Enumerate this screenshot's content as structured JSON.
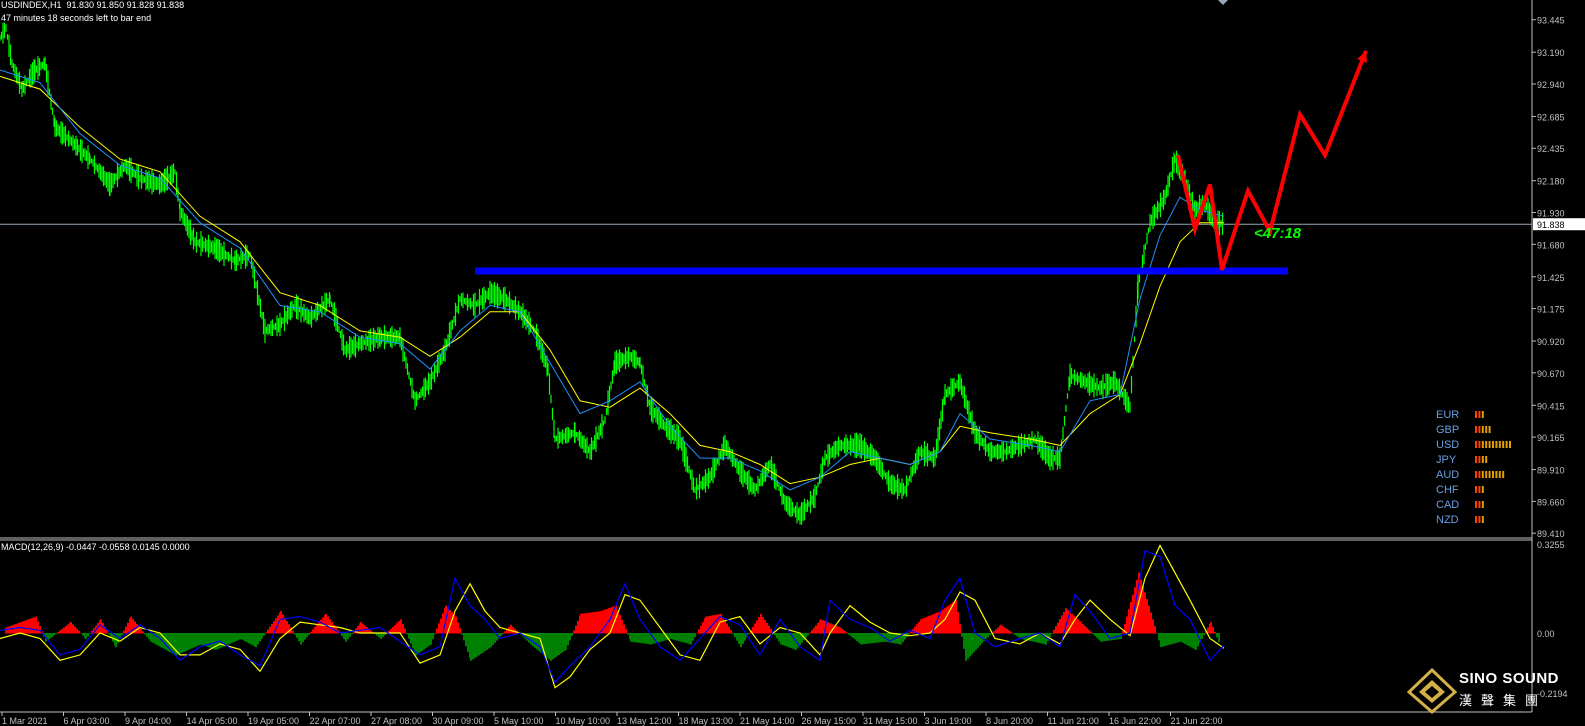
{
  "header": {
    "symbol_line": "USDINDEX,H1  91.830 91.850 91.828 91.838",
    "timer_line": "47 minutes 18 seconds left to bar end"
  },
  "macd": {
    "label": "MACD(12,26,9) -0.0447 -0.0558 0.0145 0.0000"
  },
  "countdown": "<47:18",
  "current_price": "91.838",
  "watermark": {
    "name": "SINO SOUND",
    "cjk": "漢聲集團"
  },
  "colors": {
    "candles": "#00ff00",
    "fast_ma": "#1e90ff",
    "slow_ma": "#ffff00",
    "support": "#0000ff",
    "forecast": "#ff0000",
    "histogram_up": "#ff0000",
    "histogram_down": "#008000",
    "macd_line": "#0000ff",
    "signal_line": "#ffff00",
    "axis_text": "#c0c0c0"
  },
  "chart_data": {
    "type": "line",
    "price_axis_ticks": [
      "93.445",
      "93.190",
      "92.940",
      "92.685",
      "92.435",
      "92.180",
      "91.930",
      "91.680",
      "91.425",
      "91.175",
      "90.920",
      "90.670",
      "90.415",
      "90.165",
      "89.910",
      "89.660",
      "89.410"
    ],
    "ylim": [
      89.38,
      93.6
    ],
    "macd_axis_ticks": [
      "0.3255",
      "0.00",
      "-0.2194"
    ],
    "macd_ylim": [
      -0.245,
      0.34
    ],
    "time_axis_ticks": [
      "1 Mar 2021",
      "6 Apr 03:00",
      "9 Apr 04:00",
      "14 Apr 05:00",
      "19 Apr 05:00",
      "22 Apr 07:00",
      "27 Apr 08:00",
      "30 Apr 09:00",
      "5 May 10:00",
      "10 May 10:00",
      "13 May 12:00",
      "18 May 13:00",
      "21 May 14:00",
      "26 May 15:00",
      "31 May 15:00",
      "3 Jun 19:00",
      "8 Jun 20:00",
      "11 Jun 21:00",
      "16 Jun 22:00",
      "21 Jun 22:00"
    ],
    "price_path": [
      [
        0,
        93.3
      ],
      [
        6,
        93.38
      ],
      [
        12,
        93.1
      ],
      [
        22,
        92.9
      ],
      [
        35,
        93.05
      ],
      [
        45,
        93.1
      ],
      [
        55,
        92.6
      ],
      [
        70,
        92.5
      ],
      [
        90,
        92.35
      ],
      [
        110,
        92.15
      ],
      [
        125,
        92.3
      ],
      [
        140,
        92.2
      ],
      [
        160,
        92.15
      ],
      [
        175,
        92.25
      ],
      [
        180,
        91.95
      ],
      [
        195,
        91.7
      ],
      [
        215,
        91.65
      ],
      [
        235,
        91.55
      ],
      [
        250,
        91.6
      ],
      [
        265,
        91.0
      ],
      [
        280,
        91.05
      ],
      [
        295,
        91.2
      ],
      [
        310,
        91.1
      ],
      [
        330,
        91.25
      ],
      [
        345,
        90.85
      ],
      [
        360,
        90.9
      ],
      [
        380,
        90.95
      ],
      [
        400,
        90.95
      ],
      [
        415,
        90.45
      ],
      [
        430,
        90.6
      ],
      [
        445,
        90.85
      ],
      [
        460,
        91.25
      ],
      [
        475,
        91.2
      ],
      [
        490,
        91.3
      ],
      [
        505,
        91.25
      ],
      [
        520,
        91.15
      ],
      [
        535,
        91.0
      ],
      [
        548,
        90.7
      ],
      [
        555,
        90.15
      ],
      [
        575,
        90.2
      ],
      [
        590,
        90.05
      ],
      [
        605,
        90.3
      ],
      [
        615,
        90.75
      ],
      [
        630,
        90.8
      ],
      [
        640,
        90.75
      ],
      [
        650,
        90.4
      ],
      [
        665,
        90.25
      ],
      [
        680,
        90.15
      ],
      [
        695,
        89.75
      ],
      [
        710,
        89.85
      ],
      [
        725,
        90.1
      ],
      [
        740,
        89.9
      ],
      [
        755,
        89.75
      ],
      [
        770,
        89.95
      ],
      [
        785,
        89.65
      ],
      [
        800,
        89.55
      ],
      [
        815,
        89.7
      ],
      [
        825,
        90.0
      ],
      [
        840,
        90.1
      ],
      [
        860,
        90.1
      ],
      [
        875,
        90.0
      ],
      [
        890,
        89.8
      ],
      [
        905,
        89.75
      ],
      [
        920,
        90.05
      ],
      [
        935,
        90.0
      ],
      [
        945,
        90.5
      ],
      [
        960,
        90.6
      ],
      [
        975,
        90.2
      ],
      [
        990,
        90.05
      ],
      [
        1005,
        90.05
      ],
      [
        1020,
        90.1
      ],
      [
        1035,
        90.15
      ],
      [
        1050,
        90.0
      ],
      [
        1060,
        90.0
      ],
      [
        1070,
        90.65
      ],
      [
        1085,
        90.6
      ],
      [
        1100,
        90.55
      ],
      [
        1115,
        90.6
      ],
      [
        1130,
        90.4
      ],
      [
        1138,
        91.35
      ],
      [
        1150,
        91.85
      ],
      [
        1165,
        92.05
      ],
      [
        1175,
        92.35
      ],
      [
        1185,
        92.2
      ],
      [
        1195,
        91.95
      ],
      [
        1205,
        92.0
      ],
      [
        1215,
        91.85
      ],
      [
        1224,
        91.84
      ]
    ],
    "fast_ma_path": [
      [
        0,
        93.05
      ],
      [
        40,
        92.95
      ],
      [
        80,
        92.55
      ],
      [
        120,
        92.3
      ],
      [
        160,
        92.2
      ],
      [
        200,
        91.85
      ],
      [
        240,
        91.65
      ],
      [
        280,
        91.2
      ],
      [
        320,
        91.15
      ],
      [
        360,
        90.95
      ],
      [
        400,
        90.9
      ],
      [
        430,
        90.7
      ],
      [
        460,
        91.0
      ],
      [
        490,
        91.2
      ],
      [
        520,
        91.15
      ],
      [
        550,
        90.75
      ],
      [
        580,
        90.35
      ],
      [
        610,
        90.45
      ],
      [
        640,
        90.6
      ],
      [
        670,
        90.25
      ],
      [
        700,
        90.0
      ],
      [
        730,
        90.0
      ],
      [
        760,
        89.9
      ],
      [
        790,
        89.75
      ],
      [
        820,
        89.85
      ],
      [
        850,
        90.05
      ],
      [
        880,
        90.0
      ],
      [
        910,
        89.95
      ],
      [
        940,
        90.05
      ],
      [
        960,
        90.35
      ],
      [
        990,
        90.15
      ],
      [
        1030,
        90.1
      ],
      [
        1060,
        90.05
      ],
      [
        1090,
        90.45
      ],
      [
        1120,
        90.5
      ],
      [
        1140,
        91.25
      ],
      [
        1160,
        91.75
      ],
      [
        1180,
        92.05
      ],
      [
        1200,
        91.95
      ],
      [
        1224,
        91.9
      ]
    ],
    "slow_ma_path": [
      [
        0,
        93.0
      ],
      [
        40,
        92.9
      ],
      [
        80,
        92.6
      ],
      [
        120,
        92.35
      ],
      [
        160,
        92.25
      ],
      [
        200,
        91.9
      ],
      [
        240,
        91.7
      ],
      [
        280,
        91.3
      ],
      [
        320,
        91.2
      ],
      [
        360,
        91.0
      ],
      [
        400,
        90.95
      ],
      [
        430,
        90.8
      ],
      [
        460,
        90.95
      ],
      [
        490,
        91.15
      ],
      [
        520,
        91.15
      ],
      [
        550,
        90.85
      ],
      [
        580,
        90.45
      ],
      [
        610,
        90.4
      ],
      [
        640,
        90.55
      ],
      [
        670,
        90.35
      ],
      [
        700,
        90.1
      ],
      [
        730,
        90.05
      ],
      [
        760,
        89.95
      ],
      [
        790,
        89.8
      ],
      [
        820,
        89.85
      ],
      [
        850,
        89.95
      ],
      [
        880,
        90.0
      ],
      [
        910,
        89.95
      ],
      [
        940,
        90.05
      ],
      [
        960,
        90.25
      ],
      [
        990,
        90.2
      ],
      [
        1030,
        90.15
      ],
      [
        1060,
        90.1
      ],
      [
        1090,
        90.35
      ],
      [
        1120,
        90.5
      ],
      [
        1140,
        90.9
      ],
      [
        1160,
        91.35
      ],
      [
        1180,
        91.7
      ],
      [
        1200,
        91.85
      ],
      [
        1224,
        91.85
      ]
    ],
    "support_level": 91.47,
    "support_x_range": [
      475,
      1288
    ],
    "forecast_path": [
      [
        1178,
        92.38
      ],
      [
        1195,
        91.8
      ],
      [
        1210,
        92.15
      ],
      [
        1222,
        91.48
      ],
      [
        1248,
        92.1
      ],
      [
        1270,
        91.78
      ],
      [
        1300,
        92.7
      ],
      [
        1325,
        92.38
      ],
      [
        1366,
        93.2
      ]
    ],
    "macd_histogram": [
      [
        5,
        0.02
      ],
      [
        35,
        0.06
      ],
      [
        45,
        -0.03
      ],
      [
        70,
        0.04
      ],
      [
        85,
        -0.02
      ],
      [
        100,
        0.05
      ],
      [
        115,
        -0.05
      ],
      [
        130,
        0.06
      ],
      [
        150,
        -0.03
      ],
      [
        175,
        -0.08
      ],
      [
        200,
        -0.04
      ],
      [
        215,
        -0.06
      ],
      [
        240,
        -0.02
      ],
      [
        255,
        -0.05
      ],
      [
        280,
        0.08
      ],
      [
        300,
        -0.04
      ],
      [
        325,
        0.07
      ],
      [
        345,
        -0.03
      ],
      [
        360,
        0.04
      ],
      [
        380,
        -0.02
      ],
      [
        400,
        0.05
      ],
      [
        415,
        -0.08
      ],
      [
        430,
        -0.04
      ],
      [
        445,
        0.1
      ],
      [
        455,
        0.06
      ],
      [
        470,
        -0.1
      ],
      [
        490,
        -0.05
      ],
      [
        510,
        0.03
      ],
      [
        530,
        -0.04
      ],
      [
        550,
        -0.1
      ],
      [
        565,
        -0.06
      ],
      [
        580,
        0.07
      ],
      [
        600,
        0.08
      ],
      [
        615,
        0.1
      ],
      [
        630,
        -0.03
      ],
      [
        650,
        -0.04
      ],
      [
        670,
        -0.02
      ],
      [
        690,
        -0.04
      ],
      [
        705,
        0.06
      ],
      [
        720,
        0.07
      ],
      [
        740,
        -0.05
      ],
      [
        760,
        0.07
      ],
      [
        780,
        -0.04
      ],
      [
        795,
        -0.06
      ],
      [
        820,
        0.05
      ],
      [
        840,
        0.02
      ],
      [
        860,
        -0.04
      ],
      [
        885,
        -0.03
      ],
      [
        900,
        -0.04
      ],
      [
        920,
        0.05
      ],
      [
        940,
        0.08
      ],
      [
        955,
        0.12
      ],
      [
        965,
        -0.1
      ],
      [
        985,
        -0.02
      ],
      [
        1000,
        0.03
      ],
      [
        1020,
        -0.02
      ],
      [
        1045,
        -0.04
      ],
      [
        1065,
        0.09
      ],
      [
        1080,
        0.04
      ],
      [
        1100,
        -0.03
      ],
      [
        1120,
        -0.02
      ],
      [
        1138,
        0.22
      ],
      [
        1148,
        0.1
      ],
      [
        1160,
        -0.05
      ],
      [
        1180,
        -0.03
      ],
      [
        1195,
        -0.06
      ],
      [
        1210,
        0.04
      ],
      [
        1220,
        -0.05
      ]
    ],
    "macd_line_path": [
      [
        0,
        0.01
      ],
      [
        20,
        0.02
      ],
      [
        40,
        0.01
      ],
      [
        60,
        -0.08
      ],
      [
        80,
        -0.06
      ],
      [
        100,
        0.03
      ],
      [
        120,
        -0.02
      ],
      [
        140,
        0.03
      ],
      [
        160,
        -0.02
      ],
      [
        180,
        -0.1
      ],
      [
        200,
        -0.05
      ],
      [
        220,
        -0.03
      ],
      [
        240,
        -0.08
      ],
      [
        260,
        -0.12
      ],
      [
        280,
        0.05
      ],
      [
        300,
        0.06
      ],
      [
        320,
        0.04
      ],
      [
        340,
        0.0
      ],
      [
        360,
        0.01
      ],
      [
        380,
        0.02
      ],
      [
        400,
        -0.03
      ],
      [
        420,
        -0.08
      ],
      [
        440,
        -0.05
      ],
      [
        455,
        0.2
      ],
      [
        470,
        0.1
      ],
      [
        485,
        0.05
      ],
      [
        500,
        -0.02
      ],
      [
        520,
        0.0
      ],
      [
        540,
        -0.05
      ],
      [
        555,
        -0.18
      ],
      [
        570,
        -0.12
      ],
      [
        590,
        -0.05
      ],
      [
        610,
        0.05
      ],
      [
        625,
        0.18
      ],
      [
        640,
        0.05
      ],
      [
        660,
        -0.05
      ],
      [
        680,
        -0.1
      ],
      [
        700,
        -0.02
      ],
      [
        720,
        0.06
      ],
      [
        740,
        0.03
      ],
      [
        760,
        -0.08
      ],
      [
        780,
        0.05
      ],
      [
        800,
        -0.05
      ],
      [
        820,
        -0.1
      ],
      [
        830,
        0.12
      ],
      [
        850,
        0.05
      ],
      [
        870,
        0.02
      ],
      [
        890,
        -0.03
      ],
      [
        910,
        0.01
      ],
      [
        930,
        -0.02
      ],
      [
        945,
        0.12
      ],
      [
        960,
        0.2
      ],
      [
        975,
        0.0
      ],
      [
        995,
        -0.05
      ],
      [
        1020,
        -0.02
      ],
      [
        1040,
        0.0
      ],
      [
        1060,
        -0.05
      ],
      [
        1075,
        0.14
      ],
      [
        1090,
        0.08
      ],
      [
        1110,
        -0.02
      ],
      [
        1130,
        0.0
      ],
      [
        1145,
        0.3
      ],
      [
        1160,
        0.28
      ],
      [
        1175,
        0.1
      ],
      [
        1190,
        0.05
      ],
      [
        1210,
        -0.1
      ],
      [
        1224,
        -0.045
      ]
    ],
    "signal_line_path": [
      [
        0,
        -0.02
      ],
      [
        20,
        0.0
      ],
      [
        40,
        -0.02
      ],
      [
        60,
        -0.1
      ],
      [
        80,
        -0.08
      ],
      [
        100,
        0.0
      ],
      [
        120,
        -0.03
      ],
      [
        140,
        0.02
      ],
      [
        160,
        0.0
      ],
      [
        180,
        -0.08
      ],
      [
        200,
        -0.08
      ],
      [
        220,
        -0.04
      ],
      [
        240,
        -0.06
      ],
      [
        260,
        -0.14
      ],
      [
        280,
        -0.02
      ],
      [
        300,
        0.04
      ],
      [
        320,
        0.03
      ],
      [
        340,
        0.02
      ],
      [
        360,
        0.0
      ],
      [
        380,
        0.0
      ],
      [
        400,
        0.0
      ],
      [
        420,
        -0.11
      ],
      [
        440,
        -0.08
      ],
      [
        455,
        0.08
      ],
      [
        470,
        0.18
      ],
      [
        485,
        0.08
      ],
      [
        500,
        0.02
      ],
      [
        520,
        0.0
      ],
      [
        540,
        -0.02
      ],
      [
        555,
        -0.2
      ],
      [
        570,
        -0.16
      ],
      [
        590,
        -0.06
      ],
      [
        610,
        0.0
      ],
      [
        625,
        0.14
      ],
      [
        640,
        0.12
      ],
      [
        660,
        0.02
      ],
      [
        680,
        -0.08
      ],
      [
        700,
        -0.1
      ],
      [
        720,
        0.04
      ],
      [
        740,
        0.06
      ],
      [
        760,
        -0.04
      ],
      [
        780,
        0.02
      ],
      [
        800,
        0.0
      ],
      [
        820,
        -0.08
      ],
      [
        830,
        0.0
      ],
      [
        850,
        0.1
      ],
      [
        870,
        0.04
      ],
      [
        890,
        0.0
      ],
      [
        910,
        -0.01
      ],
      [
        930,
        0.0
      ],
      [
        945,
        0.05
      ],
      [
        960,
        0.15
      ],
      [
        975,
        0.12
      ],
      [
        995,
        -0.02
      ],
      [
        1020,
        -0.04
      ],
      [
        1040,
        0.0
      ],
      [
        1060,
        -0.04
      ],
      [
        1075,
        0.05
      ],
      [
        1090,
        0.12
      ],
      [
        1110,
        0.05
      ],
      [
        1130,
        -0.01
      ],
      [
        1145,
        0.2
      ],
      [
        1160,
        0.32
      ],
      [
        1175,
        0.22
      ],
      [
        1190,
        0.12
      ],
      [
        1210,
        -0.02
      ],
      [
        1224,
        -0.056
      ]
    ]
  }
}
